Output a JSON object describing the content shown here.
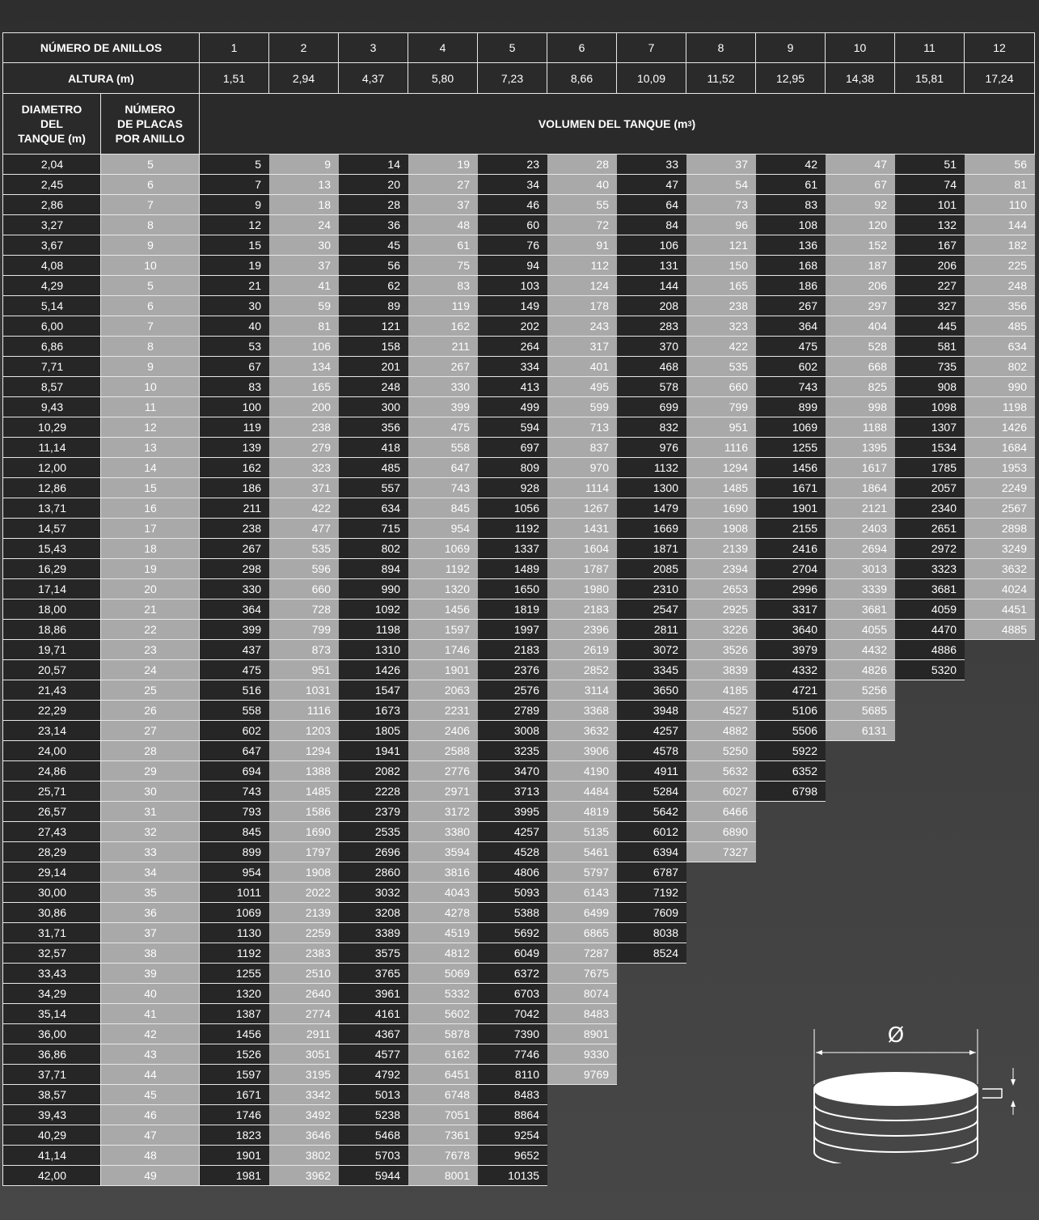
{
  "header": {
    "rings_label": "NÚMERO DE ANILLOS",
    "height_label": "ALTURA (m)",
    "diameter_label": "DIAMETRO\nDEL\nTANQUE (m)",
    "plates_label": "NÚMERO\nDE PLACAS\nPOR ANILLO",
    "volume_label": "VOLUMEN DEL TANQUE (m",
    "volume_sup": "3",
    "volume_close": ")",
    "rings": [
      "1",
      "2",
      "3",
      "4",
      "5",
      "6",
      "7",
      "8",
      "9",
      "10",
      "11",
      "12"
    ],
    "heights": [
      "1,51",
      "2,94",
      "4,37",
      "5,80",
      "7,23",
      "8,66",
      "10,09",
      "11,52",
      "12,95",
      "14,38",
      "15,81",
      "17,24"
    ]
  },
  "diagram": {
    "diameter_symbol": "Ø",
    "icon": "cylindrical-tank-icon"
  },
  "rows": [
    {
      "d": "2,04",
      "p": "5",
      "v": [
        "5",
        "9",
        "14",
        "19",
        "23",
        "28",
        "33",
        "37",
        "42",
        "47",
        "51",
        "56"
      ]
    },
    {
      "d": "2,45",
      "p": "6",
      "v": [
        "7",
        "13",
        "20",
        "27",
        "34",
        "40",
        "47",
        "54",
        "61",
        "67",
        "74",
        "81"
      ]
    },
    {
      "d": "2,86",
      "p": "7",
      "v": [
        "9",
        "18",
        "28",
        "37",
        "46",
        "55",
        "64",
        "73",
        "83",
        "92",
        "101",
        "110"
      ]
    },
    {
      "d": "3,27",
      "p": "8",
      "v": [
        "12",
        "24",
        "36",
        "48",
        "60",
        "72",
        "84",
        "96",
        "108",
        "120",
        "132",
        "144"
      ]
    },
    {
      "d": "3,67",
      "p": "9",
      "v": [
        "15",
        "30",
        "45",
        "61",
        "76",
        "91",
        "106",
        "121",
        "136",
        "152",
        "167",
        "182"
      ]
    },
    {
      "d": "4,08",
      "p": "10",
      "v": [
        "19",
        "37",
        "56",
        "75",
        "94",
        "112",
        "131",
        "150",
        "168",
        "187",
        "206",
        "225"
      ]
    },
    {
      "d": "4,29",
      "p": "5",
      "v": [
        "21",
        "41",
        "62",
        "83",
        "103",
        "124",
        "144",
        "165",
        "186",
        "206",
        "227",
        "248"
      ]
    },
    {
      "d": "5,14",
      "p": "6",
      "v": [
        "30",
        "59",
        "89",
        "119",
        "149",
        "178",
        "208",
        "238",
        "267",
        "297",
        "327",
        "356"
      ]
    },
    {
      "d": "6,00",
      "p": "7",
      "v": [
        "40",
        "81",
        "121",
        "162",
        "202",
        "243",
        "283",
        "323",
        "364",
        "404",
        "445",
        "485"
      ]
    },
    {
      "d": "6,86",
      "p": "8",
      "v": [
        "53",
        "106",
        "158",
        "211",
        "264",
        "317",
        "370",
        "422",
        "475",
        "528",
        "581",
        "634"
      ]
    },
    {
      "d": "7,71",
      "p": "9",
      "v": [
        "67",
        "134",
        "201",
        "267",
        "334",
        "401",
        "468",
        "535",
        "602",
        "668",
        "735",
        "802"
      ]
    },
    {
      "d": "8,57",
      "p": "10",
      "v": [
        "83",
        "165",
        "248",
        "330",
        "413",
        "495",
        "578",
        "660",
        "743",
        "825",
        "908",
        "990"
      ]
    },
    {
      "d": "9,43",
      "p": "11",
      "v": [
        "100",
        "200",
        "300",
        "399",
        "499",
        "599",
        "699",
        "799",
        "899",
        "998",
        "1098",
        "1198"
      ]
    },
    {
      "d": "10,29",
      "p": "12",
      "v": [
        "119",
        "238",
        "356",
        "475",
        "594",
        "713",
        "832",
        "951",
        "1069",
        "1188",
        "1307",
        "1426"
      ]
    },
    {
      "d": "11,14",
      "p": "13",
      "v": [
        "139",
        "279",
        "418",
        "558",
        "697",
        "837",
        "976",
        "1116",
        "1255",
        "1395",
        "1534",
        "1684"
      ]
    },
    {
      "d": "12,00",
      "p": "14",
      "v": [
        "162",
        "323",
        "485",
        "647",
        "809",
        "970",
        "1132",
        "1294",
        "1456",
        "1617",
        "1785",
        "1953"
      ]
    },
    {
      "d": "12,86",
      "p": "15",
      "v": [
        "186",
        "371",
        "557",
        "743",
        "928",
        "1114",
        "1300",
        "1485",
        "1671",
        "1864",
        "2057",
        "2249"
      ]
    },
    {
      "d": "13,71",
      "p": "16",
      "v": [
        "211",
        "422",
        "634",
        "845",
        "1056",
        "1267",
        "1479",
        "1690",
        "1901",
        "2121",
        "2340",
        "2567"
      ]
    },
    {
      "d": "14,57",
      "p": "17",
      "v": [
        "238",
        "477",
        "715",
        "954",
        "1192",
        "1431",
        "1669",
        "1908",
        "2155",
        "2403",
        "2651",
        "2898"
      ]
    },
    {
      "d": "15,43",
      "p": "18",
      "v": [
        "267",
        "535",
        "802",
        "1069",
        "1337",
        "1604",
        "1871",
        "2139",
        "2416",
        "2694",
        "2972",
        "3249"
      ]
    },
    {
      "d": "16,29",
      "p": "19",
      "v": [
        "298",
        "596",
        "894",
        "1192",
        "1489",
        "1787",
        "2085",
        "2394",
        "2704",
        "3013",
        "3323",
        "3632"
      ]
    },
    {
      "d": "17,14",
      "p": "20",
      "v": [
        "330",
        "660",
        "990",
        "1320",
        "1650",
        "1980",
        "2310",
        "2653",
        "2996",
        "3339",
        "3681",
        "4024"
      ]
    },
    {
      "d": "18,00",
      "p": "21",
      "v": [
        "364",
        "728",
        "1092",
        "1456",
        "1819",
        "2183",
        "2547",
        "2925",
        "3317",
        "3681",
        "4059",
        "4451"
      ]
    },
    {
      "d": "18,86",
      "p": "22",
      "v": [
        "399",
        "799",
        "1198",
        "1597",
        "1997",
        "2396",
        "2811",
        "3226",
        "3640",
        "4055",
        "4470",
        "4885"
      ]
    },
    {
      "d": "19,71",
      "p": "23",
      "v": [
        "437",
        "873",
        "1310",
        "1746",
        "2183",
        "2619",
        "3072",
        "3526",
        "3979",
        "4432",
        "4886"
      ]
    },
    {
      "d": "20,57",
      "p": "24",
      "v": [
        "475",
        "951",
        "1426",
        "1901",
        "2376",
        "2852",
        "3345",
        "3839",
        "4332",
        "4826",
        "5320"
      ]
    },
    {
      "d": "21,43",
      "p": "25",
      "v": [
        "516",
        "1031",
        "1547",
        "2063",
        "2576",
        "3114",
        "3650",
        "4185",
        "4721",
        "5256"
      ]
    },
    {
      "d": "22,29",
      "p": "26",
      "v": [
        "558",
        "1116",
        "1673",
        "2231",
        "2789",
        "3368",
        "3948",
        "4527",
        "5106",
        "5685"
      ]
    },
    {
      "d": "23,14",
      "p": "27",
      "v": [
        "602",
        "1203",
        "1805",
        "2406",
        "3008",
        "3632",
        "4257",
        "4882",
        "5506",
        "6131"
      ]
    },
    {
      "d": "24,00",
      "p": "28",
      "v": [
        "647",
        "1294",
        "1941",
        "2588",
        "3235",
        "3906",
        "4578",
        "5250",
        "5922"
      ]
    },
    {
      "d": "24,86",
      "p": "29",
      "v": [
        "694",
        "1388",
        "2082",
        "2776",
        "3470",
        "4190",
        "4911",
        "5632",
        "6352"
      ]
    },
    {
      "d": "25,71",
      "p": "30",
      "v": [
        "743",
        "1485",
        "2228",
        "2971",
        "3713",
        "4484",
        "5284",
        "6027",
        "6798"
      ]
    },
    {
      "d": "26,57",
      "p": "31",
      "v": [
        "793",
        "1586",
        "2379",
        "3172",
        "3995",
        "4819",
        "5642",
        "6466"
      ]
    },
    {
      "d": "27,43",
      "p": "32",
      "v": [
        "845",
        "1690",
        "2535",
        "3380",
        "4257",
        "5135",
        "6012",
        "6890"
      ]
    },
    {
      "d": "28,29",
      "p": "33",
      "v": [
        "899",
        "1797",
        "2696",
        "3594",
        "4528",
        "5461",
        "6394",
        "7327"
      ]
    },
    {
      "d": "29,14",
      "p": "34",
      "v": [
        "954",
        "1908",
        "2860",
        "3816",
        "4806",
        "5797",
        "6787"
      ]
    },
    {
      "d": "30,00",
      "p": "35",
      "v": [
        "1011",
        "2022",
        "3032",
        "4043",
        "5093",
        "6143",
        "7192"
      ]
    },
    {
      "d": "30,86",
      "p": "36",
      "v": [
        "1069",
        "2139",
        "3208",
        "4278",
        "5388",
        "6499",
        "7609"
      ]
    },
    {
      "d": "31,71",
      "p": "37",
      "v": [
        "1130",
        "2259",
        "3389",
        "4519",
        "5692",
        "6865",
        "8038"
      ]
    },
    {
      "d": "32,57",
      "p": "38",
      "v": [
        "1192",
        "2383",
        "3575",
        "4812",
        "6049",
        "7287",
        "8524"
      ]
    },
    {
      "d": "33,43",
      "p": "39",
      "v": [
        "1255",
        "2510",
        "3765",
        "5069",
        "6372",
        "7675"
      ]
    },
    {
      "d": "34,29",
      "p": "40",
      "v": [
        "1320",
        "2640",
        "3961",
        "5332",
        "6703",
        "8074"
      ]
    },
    {
      "d": "35,14",
      "p": "41",
      "v": [
        "1387",
        "2774",
        "4161",
        "5602",
        "7042",
        "8483"
      ]
    },
    {
      "d": "36,00",
      "p": "42",
      "v": [
        "1456",
        "2911",
        "4367",
        "5878",
        "7390",
        "8901"
      ]
    },
    {
      "d": "36,86",
      "p": "43",
      "v": [
        "1526",
        "3051",
        "4577",
        "6162",
        "7746",
        "9330"
      ]
    },
    {
      "d": "37,71",
      "p": "44",
      "v": [
        "1597",
        "3195",
        "4792",
        "6451",
        "8110",
        "9769"
      ]
    },
    {
      "d": "38,57",
      "p": "45",
      "v": [
        "1671",
        "3342",
        "5013",
        "6748",
        "8483"
      ]
    },
    {
      "d": "39,43",
      "p": "46",
      "v": [
        "1746",
        "3492",
        "5238",
        "7051",
        "8864"
      ]
    },
    {
      "d": "40,29",
      "p": "47",
      "v": [
        "1823",
        "3646",
        "5468",
        "7361",
        "9254"
      ]
    },
    {
      "d": "41,14",
      "p": "48",
      "v": [
        "1901",
        "3802",
        "5703",
        "7678",
        "9652"
      ]
    },
    {
      "d": "42,00",
      "p": "49",
      "v": [
        "1981",
        "3962",
        "5944",
        "8001",
        "10135"
      ]
    }
  ]
}
